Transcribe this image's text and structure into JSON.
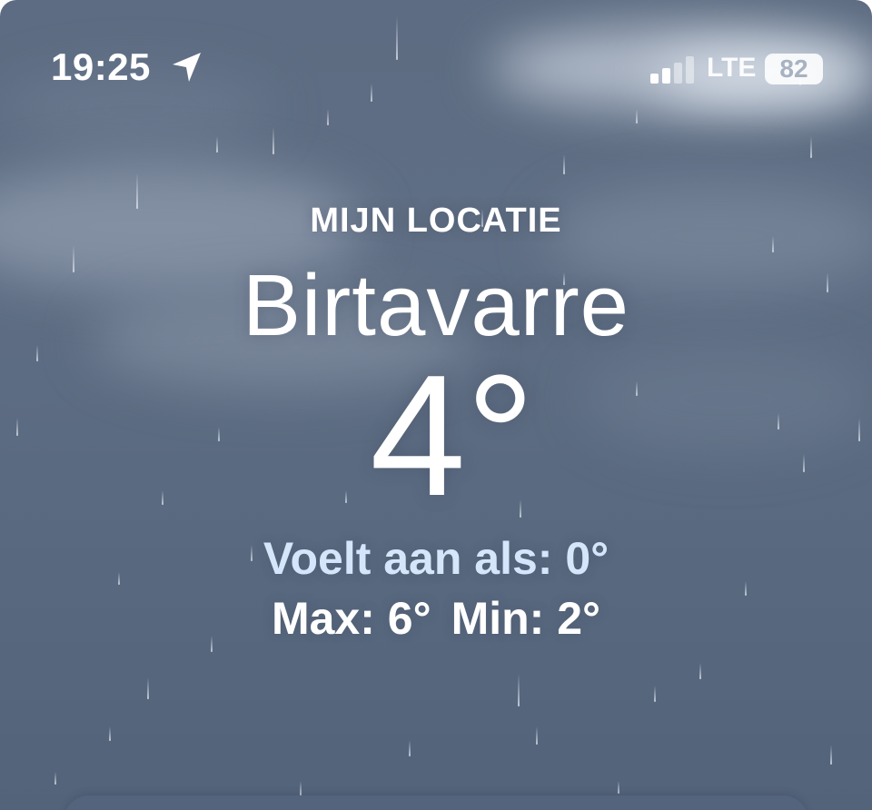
{
  "status_bar": {
    "time": "19:25",
    "location_icon": "location-arrow-icon",
    "signal_icon": "cellular-signal-icon",
    "network": "LTE",
    "battery": "82",
    "battery_icon": "battery-icon"
  },
  "weather": {
    "label": "MIJN LOCATIE",
    "city": "Birtavarre",
    "temperature": "4°",
    "feels_like": "Voelt aan als: 0°",
    "max": "Max: 6°",
    "min": "Min: 2°"
  },
  "colors": {
    "sky": "#5d6c82",
    "feels_like_text": "#d5e6fa",
    "text": "#ffffff"
  }
}
